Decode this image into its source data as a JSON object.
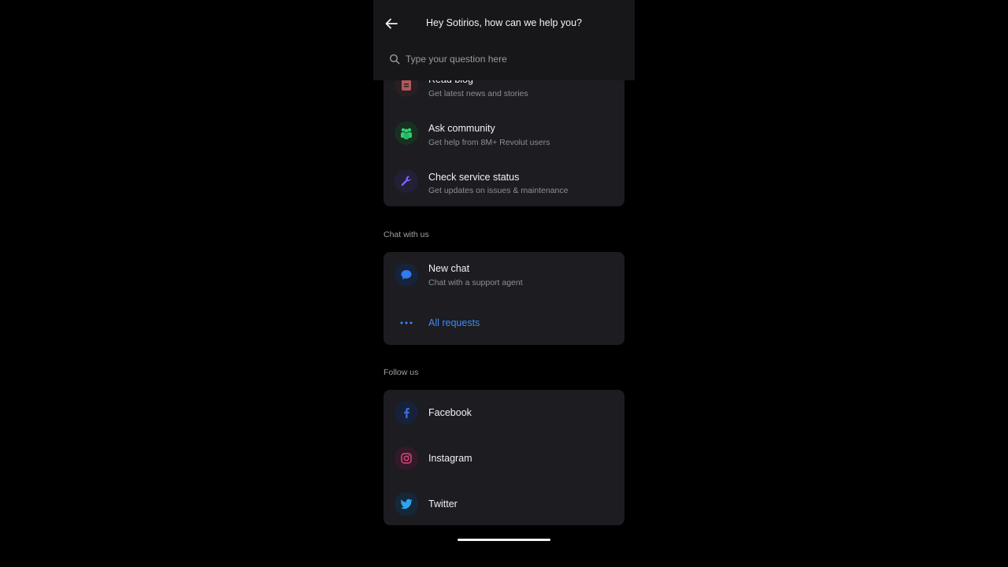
{
  "header": {
    "title": "Hey Sotirios, how can we help you?",
    "search_placeholder": "Type your question here"
  },
  "resources": [
    {
      "icon": "document-icon",
      "title": "Read blog",
      "subtitle": "Get latest news and stories",
      "color": "#c96b6b"
    },
    {
      "icon": "community-icon",
      "title": "Ask community",
      "subtitle": "Get help from 8M+ Revolut users",
      "color": "#2ecc71"
    },
    {
      "icon": "wrench-icon",
      "title": "Check service status",
      "subtitle": "Get updates on issues & maintenance",
      "color": "#7b61ff"
    }
  ],
  "chat_section": {
    "label": "Chat with us",
    "new_chat_title": "New chat",
    "new_chat_subtitle": "Chat with a support agent",
    "all_requests_label": "All requests"
  },
  "follow_section": {
    "label": "Follow us",
    "items": [
      {
        "icon": "facebook-icon",
        "label": "Facebook",
        "color": "#3b6fd8"
      },
      {
        "icon": "instagram-icon",
        "label": "Instagram",
        "color": "#d9487a"
      },
      {
        "icon": "twitter-icon",
        "label": "Twitter",
        "color": "#2da3f0"
      }
    ]
  },
  "colors": {
    "background": "#000000",
    "card": "#1c1c21",
    "accent": "#3d8bf2"
  }
}
